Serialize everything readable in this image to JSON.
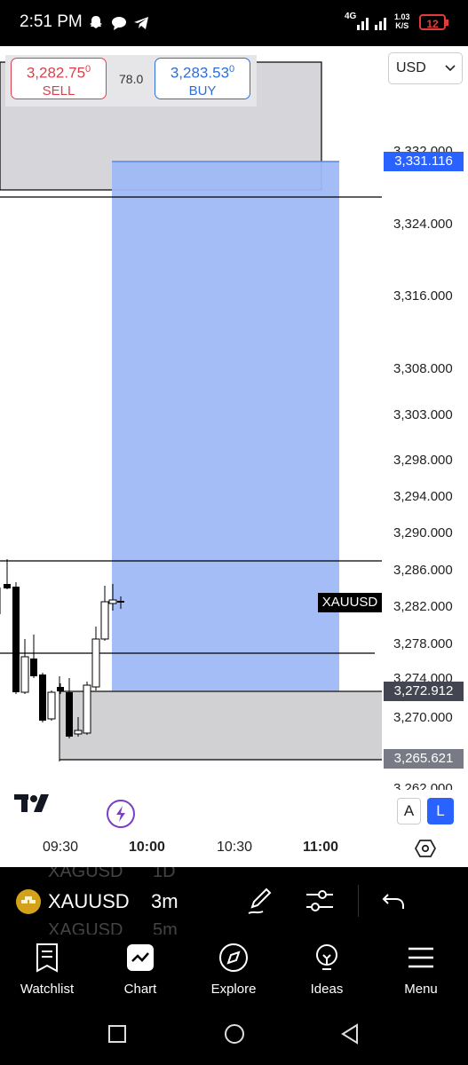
{
  "status_bar": {
    "time": "2:51 PM",
    "network": "4G",
    "speed": "1.03",
    "speed_unit": "K/S",
    "battery": "12",
    "icons": [
      "snapchat-icon",
      "chat-icon",
      "telegram-icon",
      "signal-icon",
      "battery-icon"
    ]
  },
  "trade": {
    "sell_price": "3,282.75",
    "sell_price_sup": "0",
    "sell_label": "SELL",
    "spread": "78.0",
    "buy_price": "3,283.53",
    "buy_price_sup": "0",
    "buy_label": "BUY"
  },
  "currency": {
    "selected": "USD"
  },
  "symbol_tag": "XAUUSD",
  "price_tags": {
    "upper_target": "3,331.116",
    "stop": "3,272.912",
    "lower": "3,265.621"
  },
  "price_axis": [
    {
      "label": "3,332.000"
    },
    {
      "label": "3,324.000"
    },
    {
      "label": "3,316.000"
    },
    {
      "label": "3,308.000"
    },
    {
      "label": "3,303.000"
    },
    {
      "label": "3,298.000"
    },
    {
      "label": "3,294.000"
    },
    {
      "label": "3,290.000"
    },
    {
      "label": "3,286.000"
    },
    {
      "label": "3,282.000"
    },
    {
      "label": "3,278.000"
    },
    {
      "label": "3,274.000"
    },
    {
      "label": "3,270.000"
    },
    {
      "label": "3,262.000"
    }
  ],
  "time_axis": [
    {
      "label": "09:30",
      "bold": false
    },
    {
      "label": "10:00",
      "bold": true
    },
    {
      "label": "10:30",
      "bold": false
    },
    {
      "label": "11:00",
      "bold": true
    }
  ],
  "chart_controls": {
    "auto_label": "A",
    "log_label": "L"
  },
  "toolbar": {
    "symbol": "XAUUSD",
    "interval": "3m",
    "ghost_above_symbol": "XAGUSD",
    "ghost_above_interval": "1D",
    "ghost_below_symbol": "XAGUSD",
    "ghost_below_interval": "5m"
  },
  "nav": {
    "items": [
      {
        "label": "Watchlist",
        "icon": "watchlist-icon"
      },
      {
        "label": "Chart",
        "icon": "chart-icon"
      },
      {
        "label": "Explore",
        "icon": "compass-icon"
      },
      {
        "label": "Ideas",
        "icon": "lightbulb-icon"
      },
      {
        "label": "Menu",
        "icon": "menu-icon"
      }
    ]
  },
  "colors": {
    "sell": "#d9414a",
    "buy": "#2e6fd6",
    "target_zone": "#9fb9f7",
    "stop_zone": "#c9c9cd",
    "accent": "#2962ff"
  }
}
